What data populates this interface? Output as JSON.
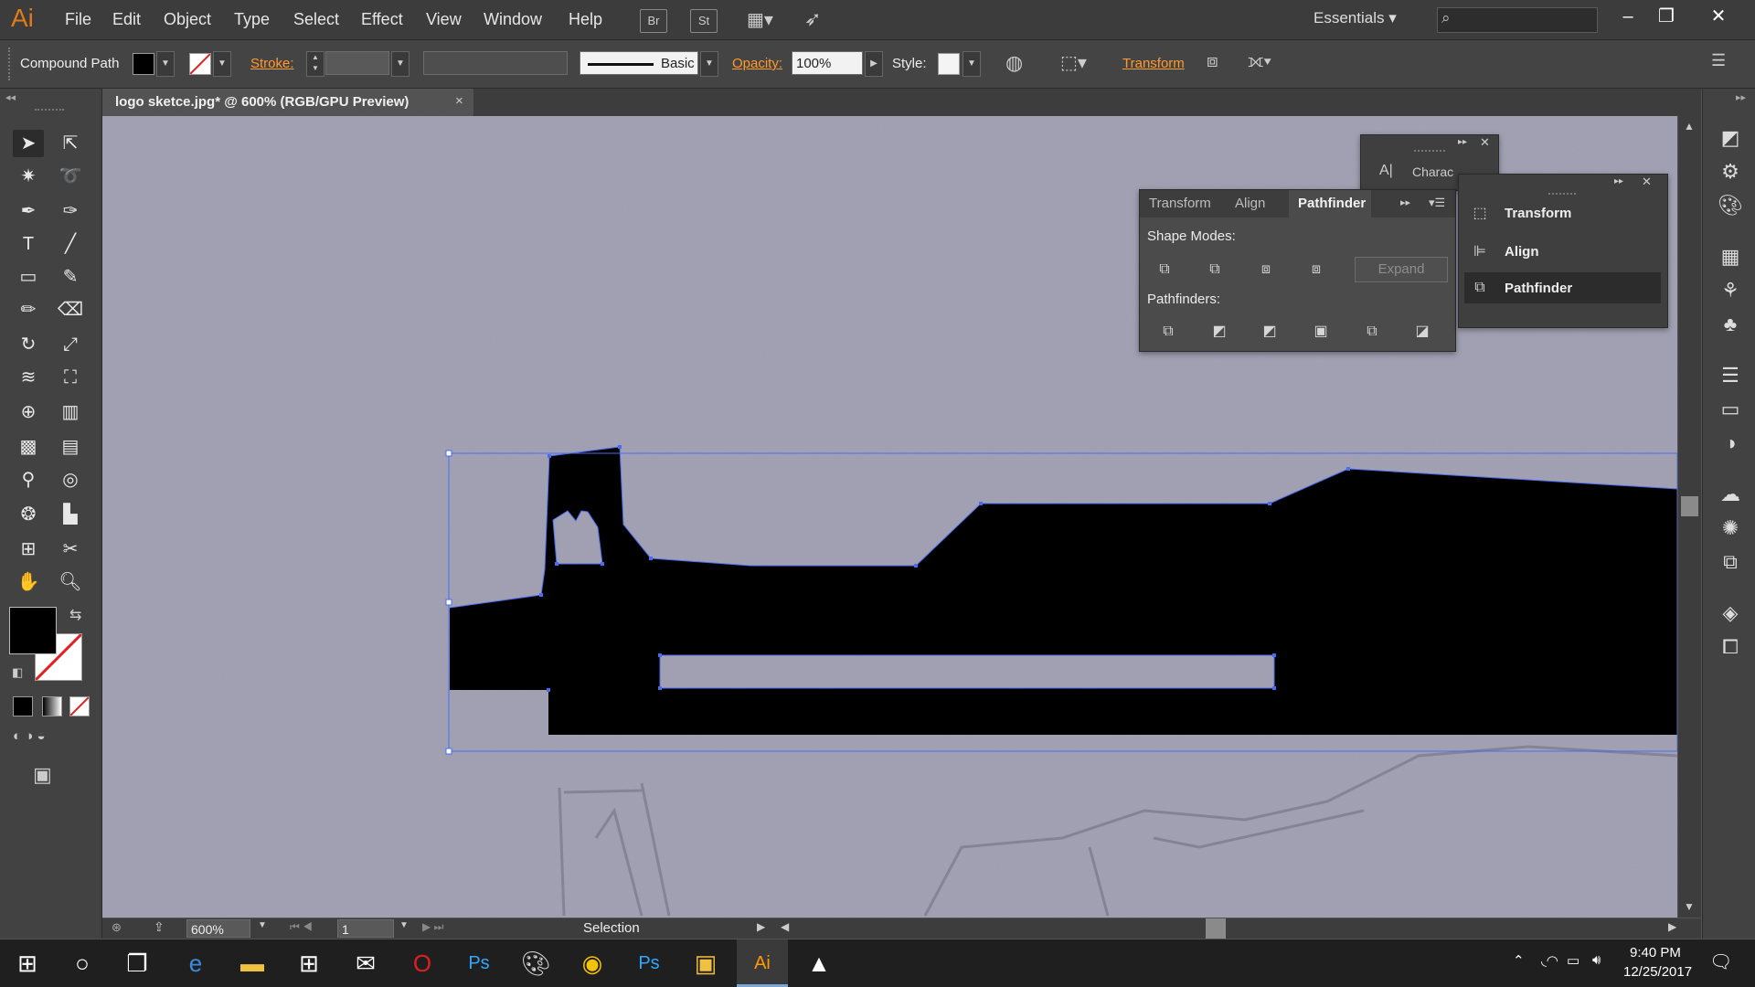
{
  "app": {
    "logo": "Ai",
    "menu": [
      "File",
      "Edit",
      "Object",
      "Type",
      "Select",
      "Effect",
      "View",
      "Window",
      "Help"
    ],
    "toolbar_buttons": [
      "Br",
      "St"
    ],
    "workspace": "Essentials",
    "search_placeholder": "",
    "window_controls": [
      "minimize-icon",
      "restore-icon",
      "close-icon"
    ]
  },
  "control_bar": {
    "selection_type": "Compound Path",
    "stroke_label": "Stroke:",
    "brush_label": "Basic",
    "opacity_label": "Opacity:",
    "opacity_value": "100%",
    "style_label": "Style:",
    "transform_label": "Transform",
    "colors": {
      "fill": "#000000",
      "stroke": "none",
      "accent": "#ff9a2f"
    }
  },
  "document": {
    "tab_title": "logo sketce.jpg* @ 600% (RGB/GPU Preview)",
    "close": "×"
  },
  "statusbar": {
    "zoom": "600%",
    "artboard": "1",
    "tool": "Selection"
  },
  "pathfinder_panel": {
    "tabs": [
      "Transform",
      "Align",
      "Pathfinder"
    ],
    "active_tab": "Pathfinder",
    "shape_modes_label": "Shape Modes:",
    "expand_label": "Expand",
    "pathfinders_label": "Pathfinders:"
  },
  "collapsed_panel": {
    "items": [
      "Transform",
      "Align",
      "Pathfinder"
    ],
    "active": "Pathfinder"
  },
  "character_panel": {
    "title": "Charac"
  },
  "taskbar": {
    "time": "9:40 PM",
    "date": "12/25/2017"
  }
}
